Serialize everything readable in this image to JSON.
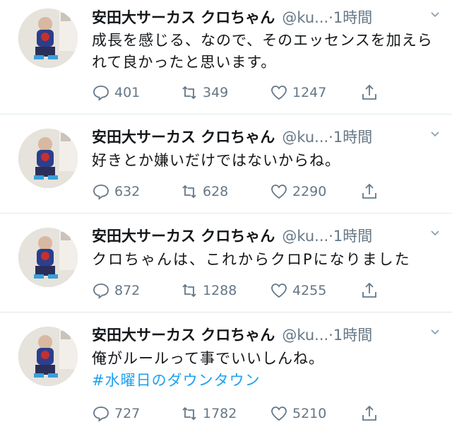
{
  "colors": {
    "text": "#14171a",
    "secondary": "#657786",
    "link": "#1da1f2",
    "divider": "#e1e8ed"
  },
  "icons": {
    "reply": "reply-icon",
    "retweet": "retweet-icon",
    "like": "heart-icon",
    "share": "share-icon",
    "menu": "chevron-down-icon"
  },
  "tweets": [
    {
      "name": "安田大サーカス クロちゃん",
      "handle": "@ku...",
      "time": "·1時間",
      "text": "成長を感じる、なので、そのエッセンスを加えられて良かったと思います。",
      "hashtag": "",
      "replies": "401",
      "retweets": "349",
      "likes": "1247"
    },
    {
      "name": "安田大サーカス クロちゃん",
      "handle": "@ku...",
      "time": "·1時間",
      "text": "好きとか嫌いだけではないからね。",
      "hashtag": "",
      "replies": "632",
      "retweets": "628",
      "likes": "2290"
    },
    {
      "name": "安田大サーカス クロちゃん",
      "handle": "@ku...",
      "time": "·1時間",
      "text": "クロちゃんは、これからクロPになりました",
      "hashtag": "",
      "replies": "872",
      "retweets": "1288",
      "likes": "4255"
    },
    {
      "name": "安田大サーカス クロちゃん",
      "handle": "@ku...",
      "time": "·1時間",
      "text": "俺がルールって事でいいしんね。",
      "hashtag": "#水曜日のダウンタウン",
      "replies": "727",
      "retweets": "1782",
      "likes": "5210"
    }
  ]
}
